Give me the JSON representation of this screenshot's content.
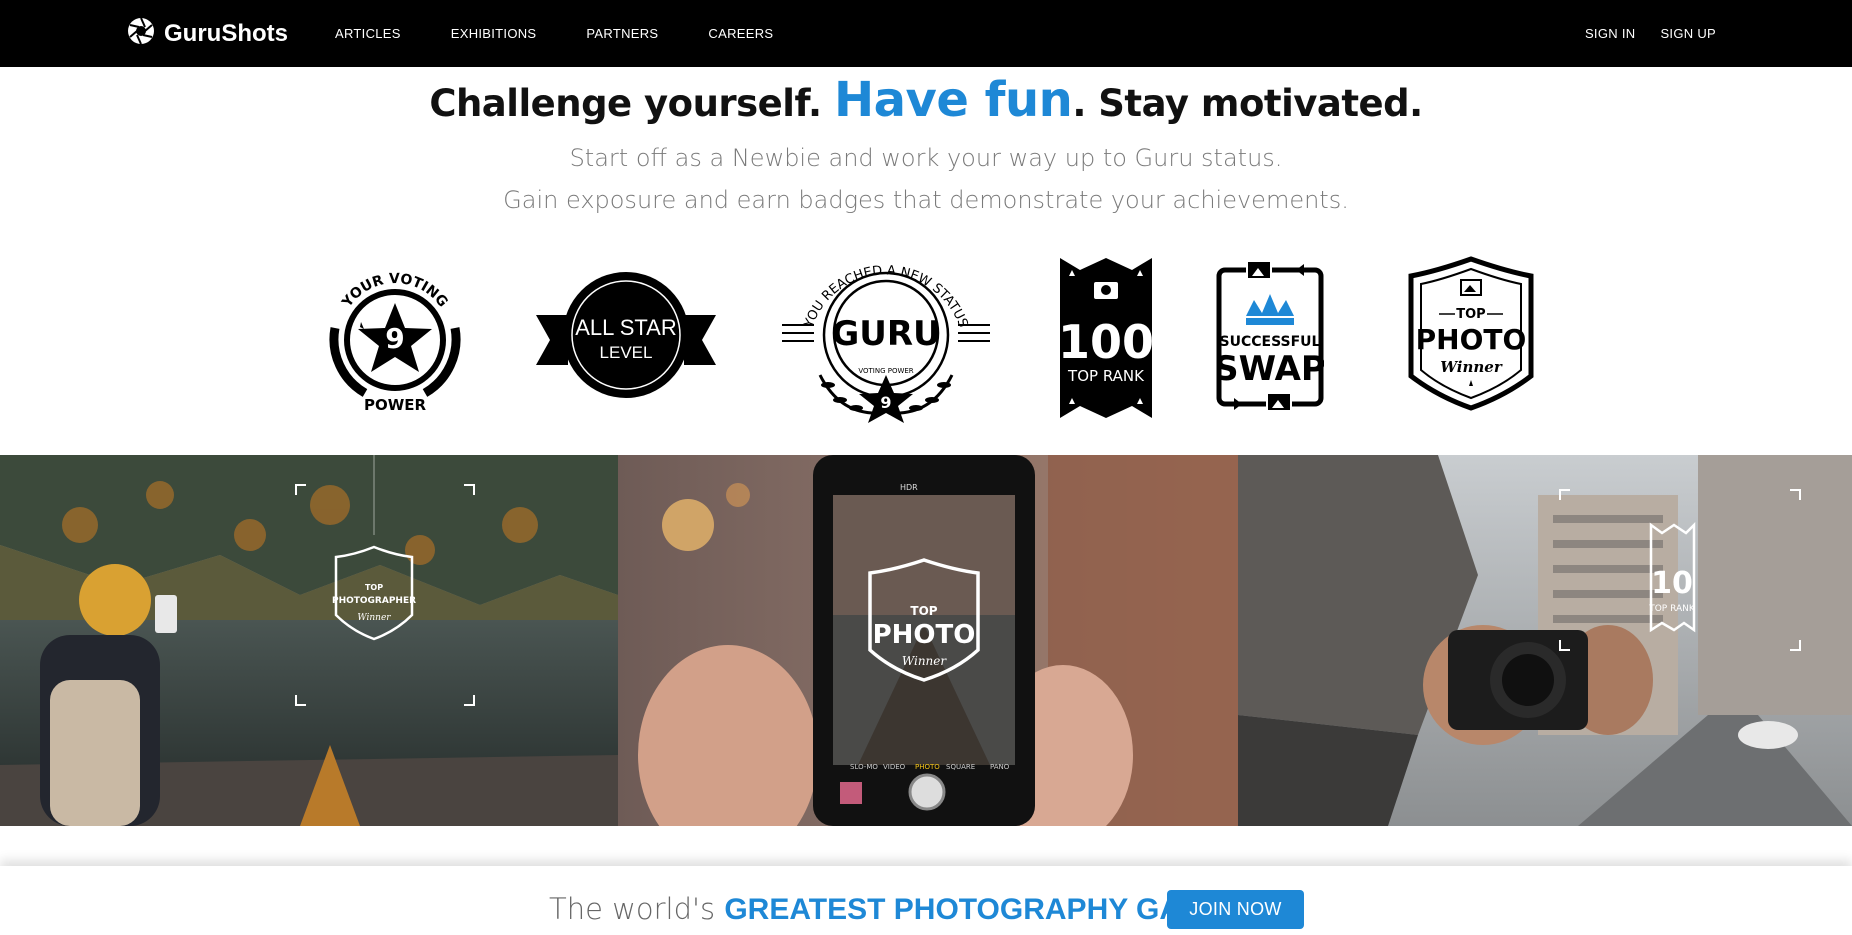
{
  "brand": {
    "name": "GuruShots"
  },
  "nav": {
    "links": [
      "ARTICLES",
      "EXHIBITIONS",
      "PARTNERS",
      "CAREERS"
    ],
    "sign_in": "SIGN IN",
    "sign_up": "SIGN UP"
  },
  "hero": {
    "headline_part1": "Challenge yourself.",
    "headline_accent": "Have fun",
    "headline_part2": ". Stay motivated.",
    "subtext_line1": "Start off as a Newbie and work your way up to Guru status.",
    "subtext_line2": "Gain exposure and earn badges that demonstrate your achievements."
  },
  "badges": {
    "voting_power": {
      "top": "YOUR VOTING",
      "number": "9",
      "bottom": "POWER"
    },
    "all_star": {
      "line1": "ALL STAR",
      "line2": "LEVEL"
    },
    "guru": {
      "arc": "YOU REACHED A NEW STATUS",
      "title": "GURU",
      "small": "VOTING POWER",
      "number": "9"
    },
    "top_rank": {
      "number": "100",
      "label": "TOP RANK"
    },
    "swap": {
      "line1": "SUCCESSFUL",
      "line2": "SWAP"
    },
    "top_photo": {
      "line1": "TOP",
      "line2": "PHOTO",
      "line3": "Winner"
    }
  },
  "photos": {
    "overlay1": {
      "line1": "TOP",
      "line2": "PHOTOGRAPHER",
      "line3": "Winner"
    },
    "overlay2": {
      "line1": "TOP",
      "line2": "PHOTO",
      "line3": "Winner"
    },
    "camera_modes": [
      "SLO-MO",
      "VIDEO",
      "PHOTO",
      "SQUARE",
      "PANO"
    ],
    "hdr": "HDR",
    "overlay3": {
      "number": "10",
      "label": "TOP RANK"
    }
  },
  "banner": {
    "text": "The world's ",
    "accent": "GREATEST PHOTOGRAPHY GAME",
    "join": "JOIN NOW"
  },
  "colors": {
    "accent": "#1e88d6",
    "nav_bg": "#000000"
  }
}
